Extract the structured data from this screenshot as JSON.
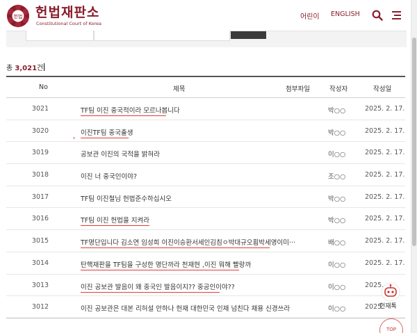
{
  "header": {
    "logo_ko": "헌법재판소",
    "logo_en": "Constitutional Court of Korea",
    "seal_text": "헌법",
    "nav_kids": "어린이",
    "nav_english": "ENGLISH"
  },
  "summary": {
    "prefix": "총 ",
    "count": "3,021",
    "suffix": "건"
  },
  "table": {
    "headers": [
      "No",
      "제목",
      "첨부파일",
      "작성자",
      "작성일"
    ],
    "rows": [
      {
        "no": "3021",
        "title": "TF팀 이진 중국적이라 모르나봅니다",
        "writer": "박○○",
        "date": "2025. 2. 17."
      },
      {
        "no": "3020",
        "title": "이진TF팀 중국출생",
        "writer": "박○○",
        "date": "2025. 2. 17."
      },
      {
        "no": "3019",
        "title": "공보관 이진의 국적을 밝혀라",
        "writer": "이○○",
        "date": "2025. 2. 17."
      },
      {
        "no": "3018",
        "title": "이진 너 중국인이야?",
        "writer": "조○○",
        "date": "2025. 2. 17."
      },
      {
        "no": "3017",
        "title": "TF팀 이진철님 헌법준수하십시오",
        "writer": "박○○",
        "date": "2025. 2. 17."
      },
      {
        "no": "3016",
        "title": "TF팀 이진 헌법을 지켜라",
        "writer": "박○○",
        "date": "2025. 2. 17."
      },
      {
        "no": "3015",
        "title": "TF명단입니다 김소연 임성희 이진이승환서세인김침ㅇ박대규오횜박세영이미···",
        "writer": "배○○",
        "date": "2025. 2. 17."
      },
      {
        "no": "3014",
        "title": "탄핵재판을 TF팀을 구성한 명단까라 천재현 ,이진 뭐해 빨랑까",
        "writer": "이○○",
        "date": "2025. 2. 17."
      },
      {
        "no": "3013",
        "title": "이진 공보관 발음이 왜 중국인 발음이지?? 중공인이야??",
        "writer": "이○○",
        "date": "2025."
      },
      {
        "no": "3012",
        "title": "이진 공보관은 대본 리허설 안하나 헌재 대한민국 인재 넘친다 채용 신경쓰라",
        "writer": "이○○",
        "date": "2025."
      }
    ]
  },
  "floating": {
    "quick_label": "헌재톡",
    "top_label": "TOP"
  },
  "colors": {
    "brand": "#8a1c2b",
    "annotation": "#e23b3b"
  }
}
